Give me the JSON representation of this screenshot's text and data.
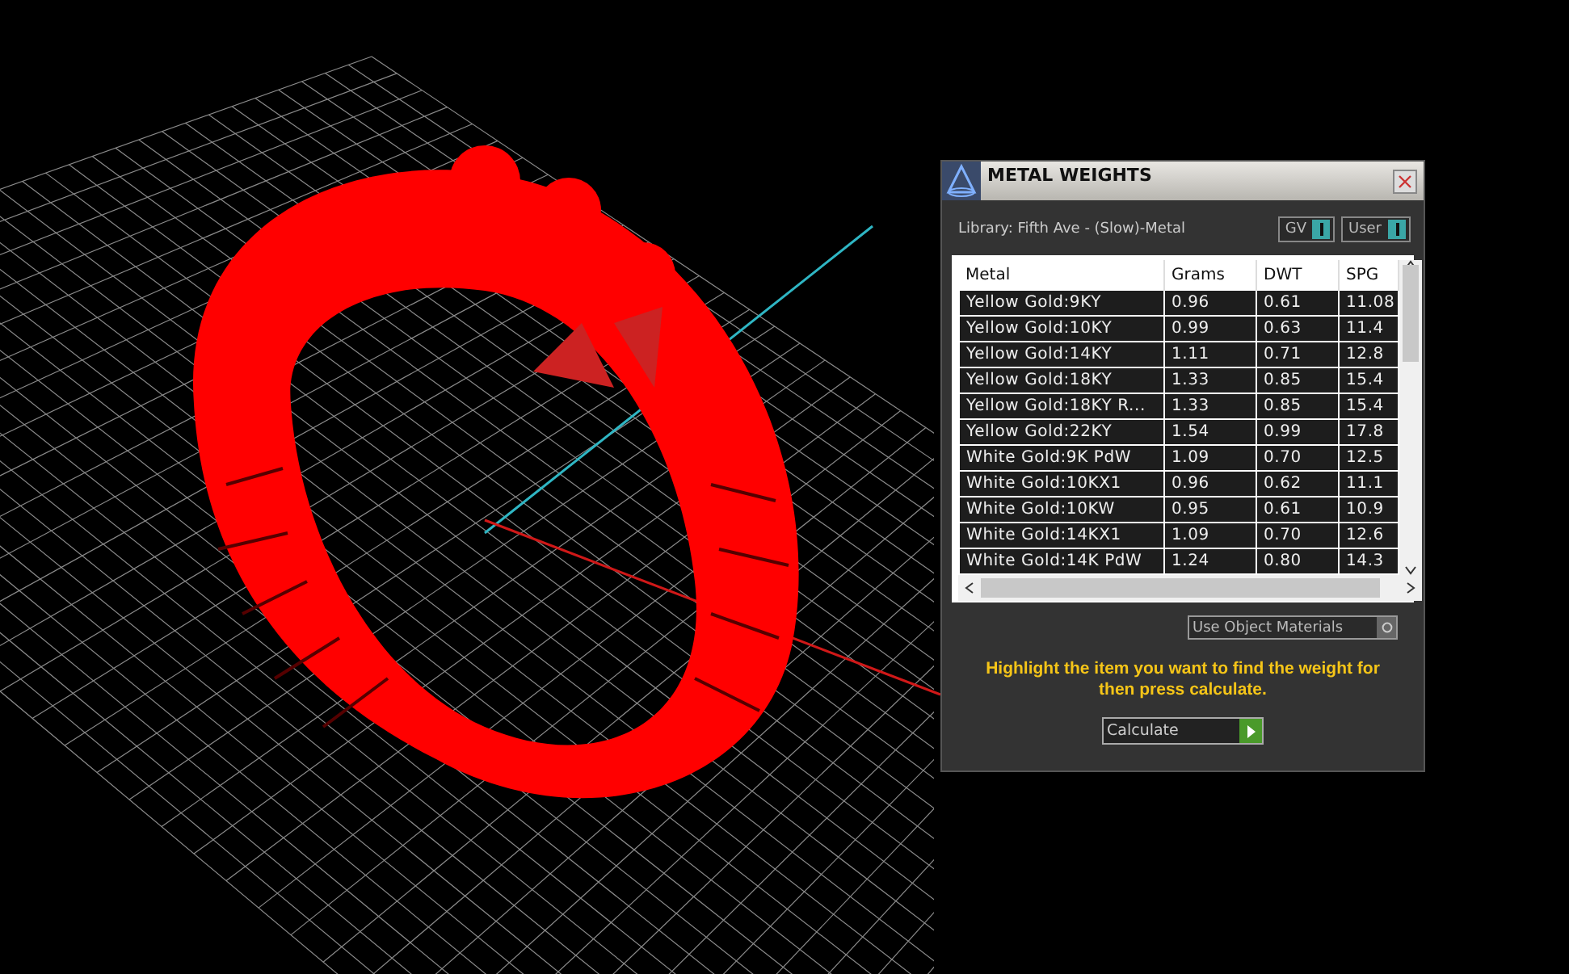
{
  "panel": {
    "title": "METAL WEIGHTS",
    "library": "Library: Fifth Ave - (Slow)-Metal",
    "toggles": [
      {
        "label": "GV",
        "on": true
      },
      {
        "label": "User",
        "on": true
      }
    ],
    "table": {
      "columns": [
        "Metal",
        "Grams",
        "DWT",
        "SPG"
      ],
      "rows": [
        [
          "Yellow Gold:9KY",
          "0.96",
          "0.61",
          "11.08"
        ],
        [
          "Yellow Gold:10KY",
          "0.99",
          "0.63",
          "11.4"
        ],
        [
          "Yellow Gold:14KY",
          "1.11",
          "0.71",
          "12.8"
        ],
        [
          "Yellow Gold:18KY",
          "1.33",
          "0.85",
          "15.4"
        ],
        [
          "Yellow Gold:18KY R...",
          "1.33",
          "0.85",
          "15.4"
        ],
        [
          "Yellow Gold:22KY",
          "1.54",
          "0.99",
          "17.8"
        ],
        [
          "White Gold:9K PdW",
          "1.09",
          "0.70",
          "12.5"
        ],
        [
          "White Gold:10KX1",
          "0.96",
          "0.62",
          "11.1"
        ],
        [
          "White Gold:10KW",
          "0.95",
          "0.61",
          "10.9"
        ],
        [
          "White Gold:14KX1",
          "1.09",
          "0.70",
          "12.6"
        ],
        [
          "White Gold:14K PdW",
          "1.24",
          "0.80",
          "14.3"
        ]
      ]
    },
    "use_object_materials": {
      "label": "Use Object Materials",
      "on": false
    },
    "hint": "Highlight the item you want to find the weight for then press calculate.",
    "calculate": "Calculate"
  }
}
